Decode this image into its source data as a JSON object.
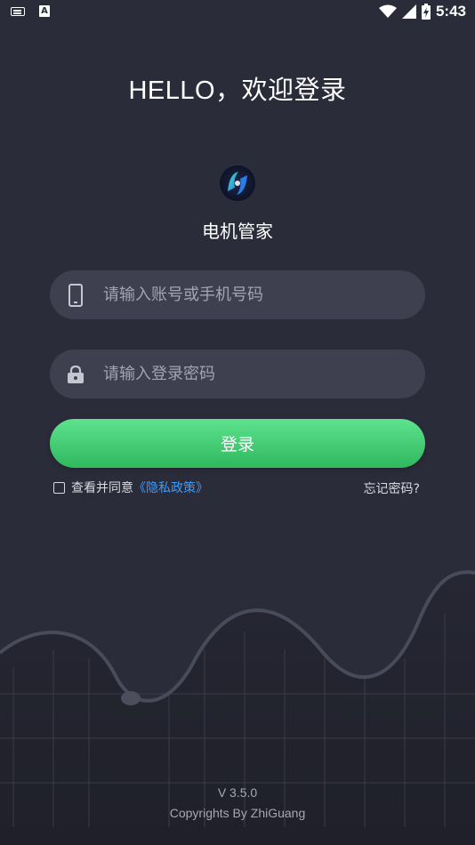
{
  "status_bar": {
    "time": "5:43",
    "icons": [
      "keyboard-icon",
      "a-app-icon",
      "wifi-icon",
      "signal-icon",
      "battery-icon"
    ]
  },
  "header": {
    "greeting": "HELLO，欢迎登录"
  },
  "app": {
    "logo_icon": "app-logo-icon",
    "name": "电机管家"
  },
  "form": {
    "account_placeholder": "请输入账号或手机号码",
    "account_value": "",
    "account_icon": "phone-icon",
    "password_placeholder": "请输入登录密码",
    "password_value": "",
    "password_icon": "lock-icon",
    "login_label": "登录",
    "agree_prefix": "查看并同意",
    "policy_link": "《隐私政策》",
    "agree_checked": false,
    "forgot_label": "忘记密码?"
  },
  "footer": {
    "version": "V 3.5.0",
    "copyright": "Copyrights By ZhiGuang"
  },
  "colors": {
    "background": "#2b2c3a",
    "field": "#3e3f4f",
    "accent_green": "#3ccf72",
    "link_blue": "#3d9bff"
  }
}
